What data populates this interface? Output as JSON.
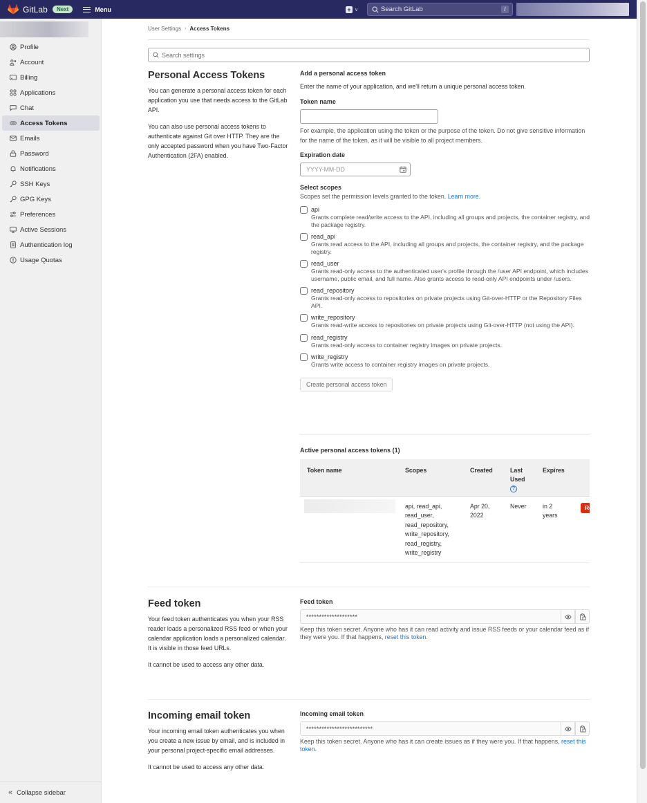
{
  "navbar": {
    "brand": "GitLab",
    "badge": "Next",
    "menu_label": "Menu",
    "search_placeholder": "Search GitLab",
    "search_shortcut": "/",
    "new_icon": "plus-square-icon",
    "colors": {
      "navbar_bg": "#292961",
      "accent": "#1f75cb",
      "danger": "#dd2b0e"
    }
  },
  "sidebar": {
    "items": [
      {
        "label": "Profile",
        "icon": "profile-icon"
      },
      {
        "label": "Account",
        "icon": "account-icon"
      },
      {
        "label": "Billing",
        "icon": "billing-icon"
      },
      {
        "label": "Applications",
        "icon": "applications-icon"
      },
      {
        "label": "Chat",
        "icon": "comment-icon"
      },
      {
        "label": "Access Tokens",
        "icon": "token-icon",
        "active": true
      },
      {
        "label": "Emails",
        "icon": "mail-icon"
      },
      {
        "label": "Password",
        "icon": "lock-icon"
      },
      {
        "label": "Notifications",
        "icon": "bell-icon"
      },
      {
        "label": "SSH Keys",
        "icon": "key-icon"
      },
      {
        "label": "GPG Keys",
        "icon": "key-icon"
      },
      {
        "label": "Preferences",
        "icon": "preferences-icon"
      },
      {
        "label": "Active Sessions",
        "icon": "monitor-icon"
      },
      {
        "label": "Authentication log",
        "icon": "log-icon"
      },
      {
        "label": "Usage Quotas",
        "icon": "quota-icon"
      }
    ],
    "collapse_label": "Collapse sidebar"
  },
  "breadcrumb": {
    "parent": "User Settings",
    "current": "Access Tokens"
  },
  "settings_search": {
    "placeholder": "Search settings"
  },
  "pat": {
    "title": "Personal Access Tokens",
    "desc1": "You can generate a personal access token for each application you use that needs access to the GitLab API.",
    "desc2": "You can also use personal access tokens to authenticate against Git over HTTP. They are the only accepted password when you have Two-Factor Authentication (2FA) enabled.",
    "form": {
      "heading": "Add a personal access token",
      "intro": "Enter the name of your application, and we'll return a unique personal access token.",
      "token_name_label": "Token name",
      "token_name_value": "",
      "token_name_help": "For example, the application using the token or the purpose of the token. Do not give sensitive information for the name of the token, as it will be visible to all project members.",
      "expiration_label": "Expiration date",
      "expiration_placeholder": "YYYY-MM-DD",
      "scopes_label": "Select scopes",
      "scopes_help": "Scopes set the permission levels granted to the token.",
      "learn_more": "Learn more.",
      "scopes": [
        {
          "name": "api",
          "checked": false,
          "desc": "Grants complete read/write access to the API, including all groups and projects, the container registry, and the package registry."
        },
        {
          "name": "read_api",
          "checked": false,
          "desc": "Grants read access to the API, including all groups and projects, the container registry, and the package registry."
        },
        {
          "name": "read_user",
          "checked": false,
          "desc": "Grants read-only access to the authenticated user's profile through the /user API endpoint, which includes username, public email, and full name. Also grants access to read-only API endpoints under /users."
        },
        {
          "name": "read_repository",
          "checked": false,
          "desc": "Grants read-only access to repositories on private projects using Git-over-HTTP or the Repository Files API."
        },
        {
          "name": "write_repository",
          "checked": false,
          "desc": "Grants read-write access to repositories on private projects using Git-over-HTTP (not using the API)."
        },
        {
          "name": "read_registry",
          "checked": false,
          "desc": "Grants read-only access to container registry images on private projects."
        },
        {
          "name": "write_registry",
          "checked": false,
          "desc": "Grants write access to container registry images on private projects."
        }
      ],
      "create_button": "Create personal access token"
    },
    "active": {
      "heading": "Active personal access tokens (1)",
      "columns": [
        "Token name",
        "Scopes",
        "Created",
        "Last Used",
        "Expires"
      ],
      "help_icon": "question-circle-icon",
      "rows": [
        {
          "token_name": "",
          "scopes": [
            "api, read_api,",
            "read_user,",
            "read_repository,",
            "write_repository,",
            "read_registry,",
            "write_registry"
          ],
          "created": [
            "Apr 20,",
            "2022"
          ],
          "last_used": "Never",
          "expires": [
            "in 2",
            "years"
          ],
          "action": "Re"
        }
      ]
    }
  },
  "feed": {
    "title": "Feed token",
    "desc1": "Your feed token authenticates you when your RSS reader loads a personalized RSS feed or when your calendar application loads a personalized calendar. It is visible in those feed URLs.",
    "desc2": "It cannot be used to access any other data.",
    "label": "Feed token",
    "value": "********************",
    "help": "Keep this token secret. Anyone who has it can read activity and issue RSS feeds or your calendar feed as if they were you. If that happens,",
    "reset_link": "reset this token."
  },
  "incoming": {
    "title": "Incoming email token",
    "desc1": "Your incoming email token authenticates you when you create a new issue by email, and is included in your personal project-specific email addresses.",
    "desc2": "It cannot be used to access any other data.",
    "label": "Incoming email token",
    "value": "**************************",
    "help": "Keep this token secret. Anyone who has it can create issues as if they were you. If that happens,",
    "reset_link": "reset this token."
  }
}
